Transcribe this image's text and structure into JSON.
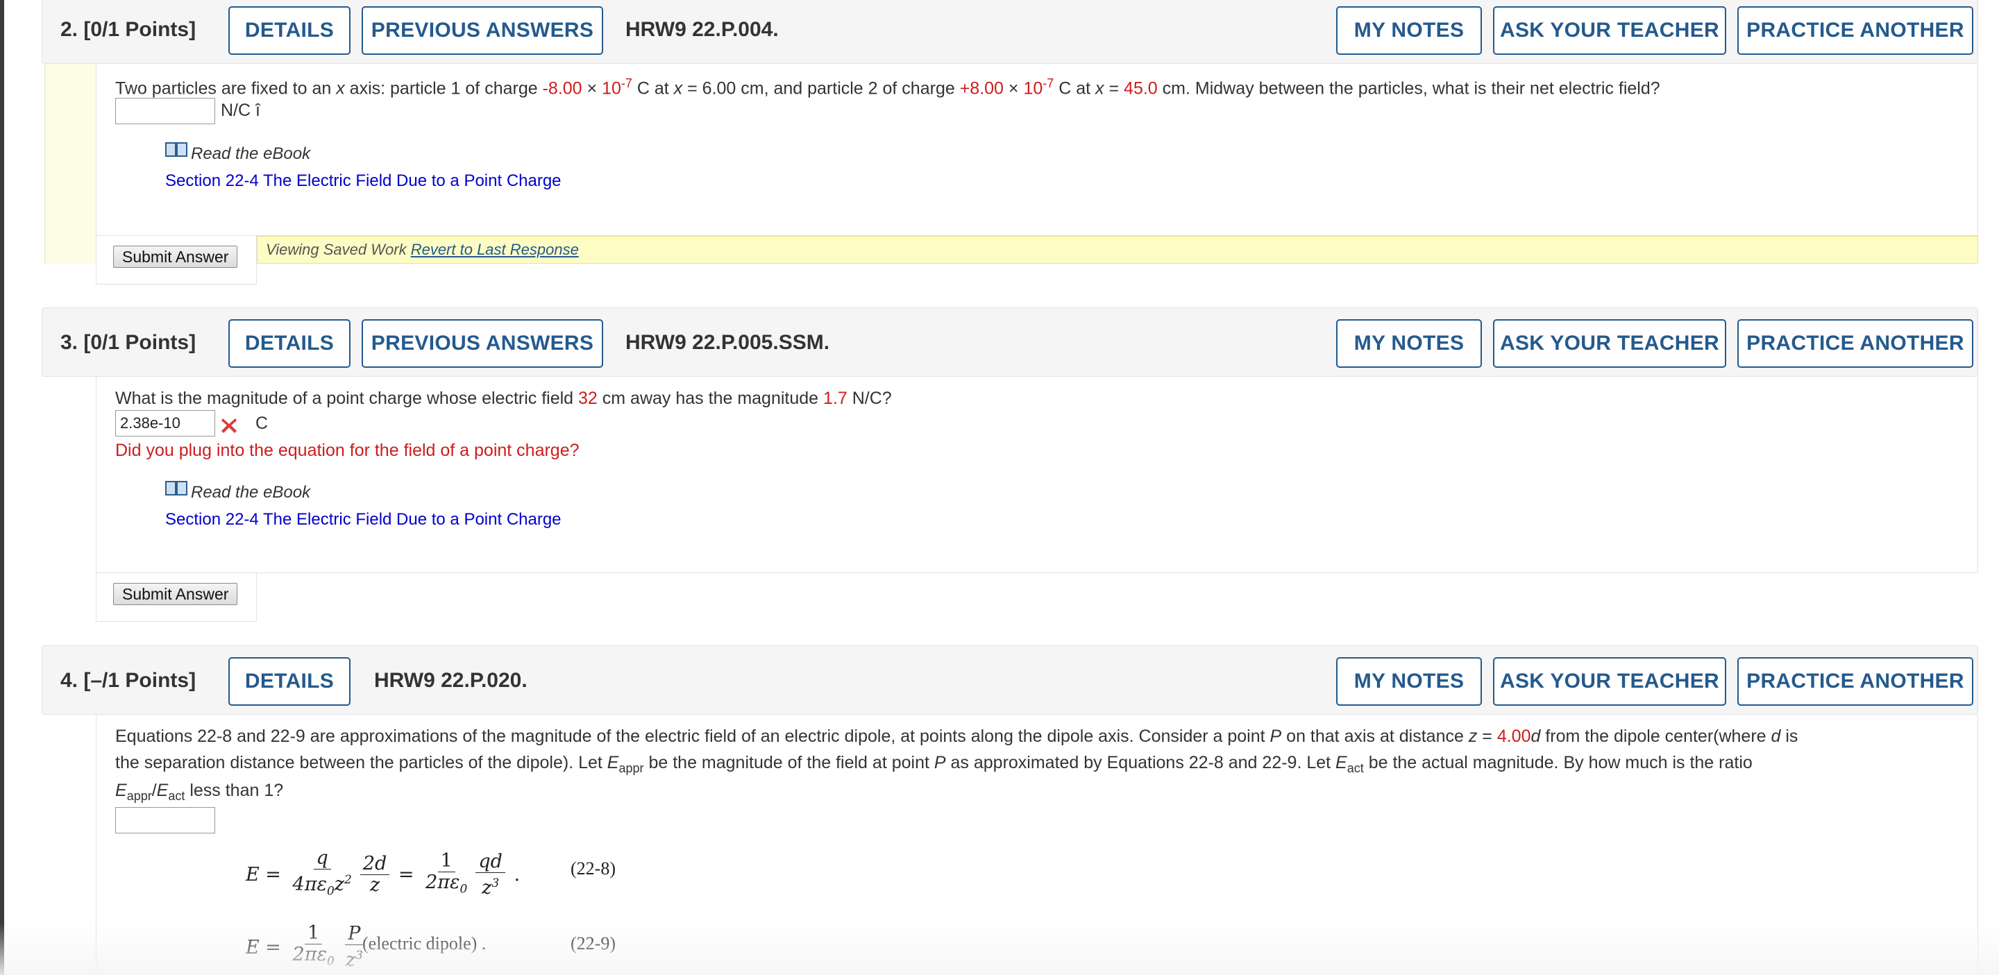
{
  "colors": {
    "accent": "#245a8d",
    "error": "#cc1d1d",
    "link": "#0000cc",
    "saved_bg": "#fdfcc4"
  },
  "questions": [
    {
      "number": "2.",
      "points": "[0/1 Points]",
      "details_label": "DETAILS",
      "previous_answers_label": "PREVIOUS ANSWERS",
      "code": "HRW9 22.P.004.",
      "my_notes_label": "MY NOTES",
      "ask_teacher_label": "ASK YOUR TEACHER",
      "practice_label": "PRACTICE ANOTHER",
      "text_parts": {
        "t1": "Two particles are fixed to an ",
        "x1": "x",
        "t2": " axis: particle 1 of charge ",
        "c1": "-8.00",
        "times1": " × ",
        "ten1": "10",
        "exp1": "-7",
        "t3": " C at ",
        "x2": "x",
        "t4": " = 6.00 cm, and particle 2 of charge ",
        "c2": "+8.00",
        "times2": " × ",
        "ten2": "10",
        "exp2": "-7",
        "t5": " C at ",
        "x3": "x",
        "t6": " = ",
        "pos2": "45.0",
        "t7": " cm. Midway between the particles, what is their net electric field?"
      },
      "answer_value": "",
      "unit": "N/C î",
      "ebook_label": "Read the eBook",
      "section_link": "Section 22-4 The Electric Field Due to a Point Charge",
      "submit_label": "Submit Answer",
      "saved_text": "Viewing Saved Work ",
      "revert_label": "Revert to Last Response"
    },
    {
      "number": "3.",
      "points": "[0/1 Points]",
      "details_label": "DETAILS",
      "previous_answers_label": "PREVIOUS ANSWERS",
      "code": "HRW9 22.P.005.SSM.",
      "my_notes_label": "MY NOTES",
      "ask_teacher_label": "ASK YOUR TEACHER",
      "practice_label": "PRACTICE ANOTHER",
      "text_parts": {
        "t1": "What is the magnitude of a point charge whose electric field ",
        "dist": "32",
        "t2": " cm away has the magnitude ",
        "field": "1.7",
        "t3": " N/C?"
      },
      "answer_value": "2.38e-10",
      "unit": "C",
      "feedback": "Did you plug into the equation for the field of a point charge?",
      "ebook_label": "Read the eBook",
      "section_link": "Section 22-4 The Electric Field Due to a Point Charge",
      "submit_label": "Submit Answer"
    },
    {
      "number": "4.",
      "points": "[–/1 Points]",
      "details_label": "DETAILS",
      "code": "HRW9 22.P.020.",
      "my_notes_label": "MY NOTES",
      "ask_teacher_label": "ASK YOUR TEACHER",
      "practice_label": "PRACTICE ANOTHER",
      "text_parts": {
        "l1a": "Equations 22-8 and 22-9 are approximations of the magnitude of the electric field of an electric dipole, at points along the dipole axis. Consider a point ",
        "P1": "P",
        "l1b": " on that axis at distance ",
        "z": "z",
        "l1c": " = ",
        "zval": "4.00",
        "d1": "d",
        "l1d": " from the dipole center(where ",
        "d2": "d",
        "l1e": " is",
        "l2a": "the separation distance between the particles of the dipole). Let ",
        "E1": "E",
        "appr1": "appr",
        "l2b": " be the magnitude of the field at point ",
        "P2": "P",
        "l2c": " as approximated by Equations 22-8 and 22-9. Let ",
        "E2": "E",
        "act1": "act",
        "l2d": " be the actual magnitude. By how much is the ratio",
        "E3": "E",
        "appr2": "appr",
        "slash": "/",
        "E4": "E",
        "act2": "act",
        "l3": " less than 1?"
      },
      "answer_value": "",
      "eq1_number": "(22-8)",
      "eq2_number": "(22-9)",
      "eq2_note": "(electric dipole) ."
    }
  ]
}
